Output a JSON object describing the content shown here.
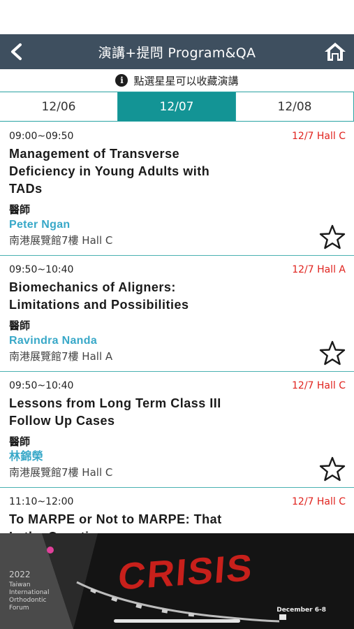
{
  "header": {
    "title": "演講+提問 Program&QA"
  },
  "notice": {
    "text": "點選星星可以收藏演講"
  },
  "tabs": [
    {
      "label": "12/06",
      "active": false
    },
    {
      "label": "12/07",
      "active": true
    },
    {
      "label": "12/08",
      "active": false
    }
  ],
  "talks": [
    {
      "time": "09:00~09:50",
      "hall_tag": "12/7 Hall C",
      "title": "Management of Transverse Deficiency in Young Adults with TADs",
      "role": "醫師",
      "speaker": "Peter Ngan",
      "venue": "南港展覽館7樓 Hall C"
    },
    {
      "time": "09:50~10:40",
      "hall_tag": "12/7 Hall A",
      "title": "Biomechanics of Aligners: Limitations and Possibilities",
      "role": "醫師",
      "speaker": "Ravindra Nanda",
      "venue": "南港展覽館7樓 Hall A"
    },
    {
      "time": "09:50~10:40",
      "hall_tag": "12/7 Hall C",
      "title": "Lessons from Long Term Class III Follow Up Cases",
      "role": "醫師",
      "speaker": "林錦榮",
      "venue": "南港展覽館7樓 Hall C"
    },
    {
      "time": "11:10~12:00",
      "hall_tag": "12/7 Hall C",
      "title": "To MARPE or Not to MARPE: That Is the Question",
      "role": "",
      "speaker": "",
      "venue": ""
    }
  ],
  "banner": {
    "year": "2022",
    "lines": [
      "Taiwan",
      "International",
      "Orthodontic",
      "Forum"
    ],
    "headline": "CRISIS",
    "date_text": "December 6-8"
  },
  "colors": {
    "header_bg": "#3e4f5f",
    "accent_teal": "#139495",
    "hall_red": "#e0221d",
    "speaker_blue": "#38a8c8"
  }
}
